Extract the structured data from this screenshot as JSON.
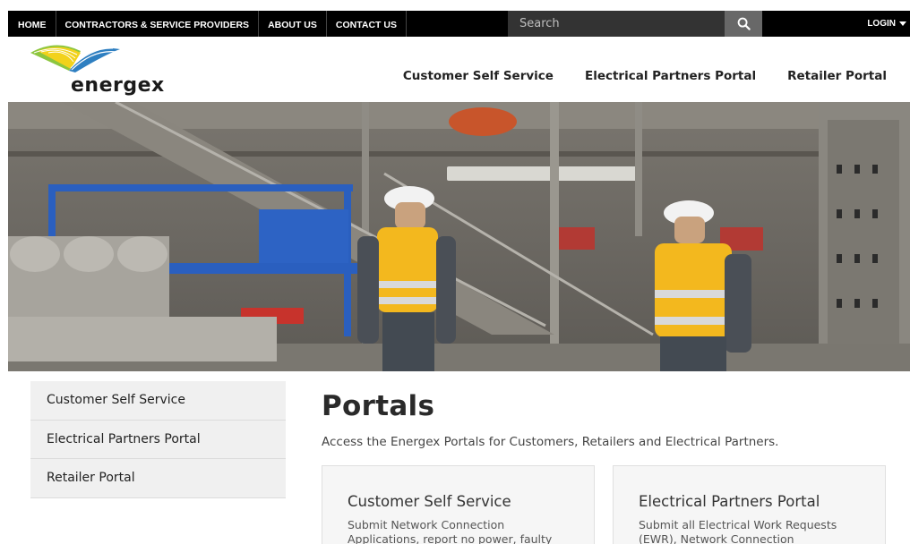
{
  "topbar": {
    "nav": [
      "HOME",
      "CONTRACTORS & SERVICE PROVIDERS",
      "ABOUT US",
      "CONTACT US"
    ],
    "search_placeholder": "Search",
    "login_label": "LOGIN"
  },
  "header": {
    "logo_text": "energex",
    "nav": [
      "Customer Self Service",
      "Electrical Partners Portal",
      "Retailer Portal"
    ]
  },
  "sidebar": {
    "items": [
      "Customer Self Service",
      "Electrical Partners Portal",
      "Retailer Portal"
    ]
  },
  "main": {
    "title": "Portals",
    "intro": "Access the Energex Portals for Customers, Retailers and Electrical Partners.",
    "cards": [
      {
        "title": "Customer Self Service",
        "text": "Submit Network Connection Applications, report no power, faulty"
      },
      {
        "title": "Electrical Partners Portal",
        "text": "Submit all Electrical Work Requests (EWR), Network Connection"
      }
    ]
  },
  "colors": {
    "logo_green": "#8dc63f",
    "logo_yellow": "#f2d21b",
    "logo_blue": "#2e7fc1",
    "topbar_bg": "#000000"
  }
}
